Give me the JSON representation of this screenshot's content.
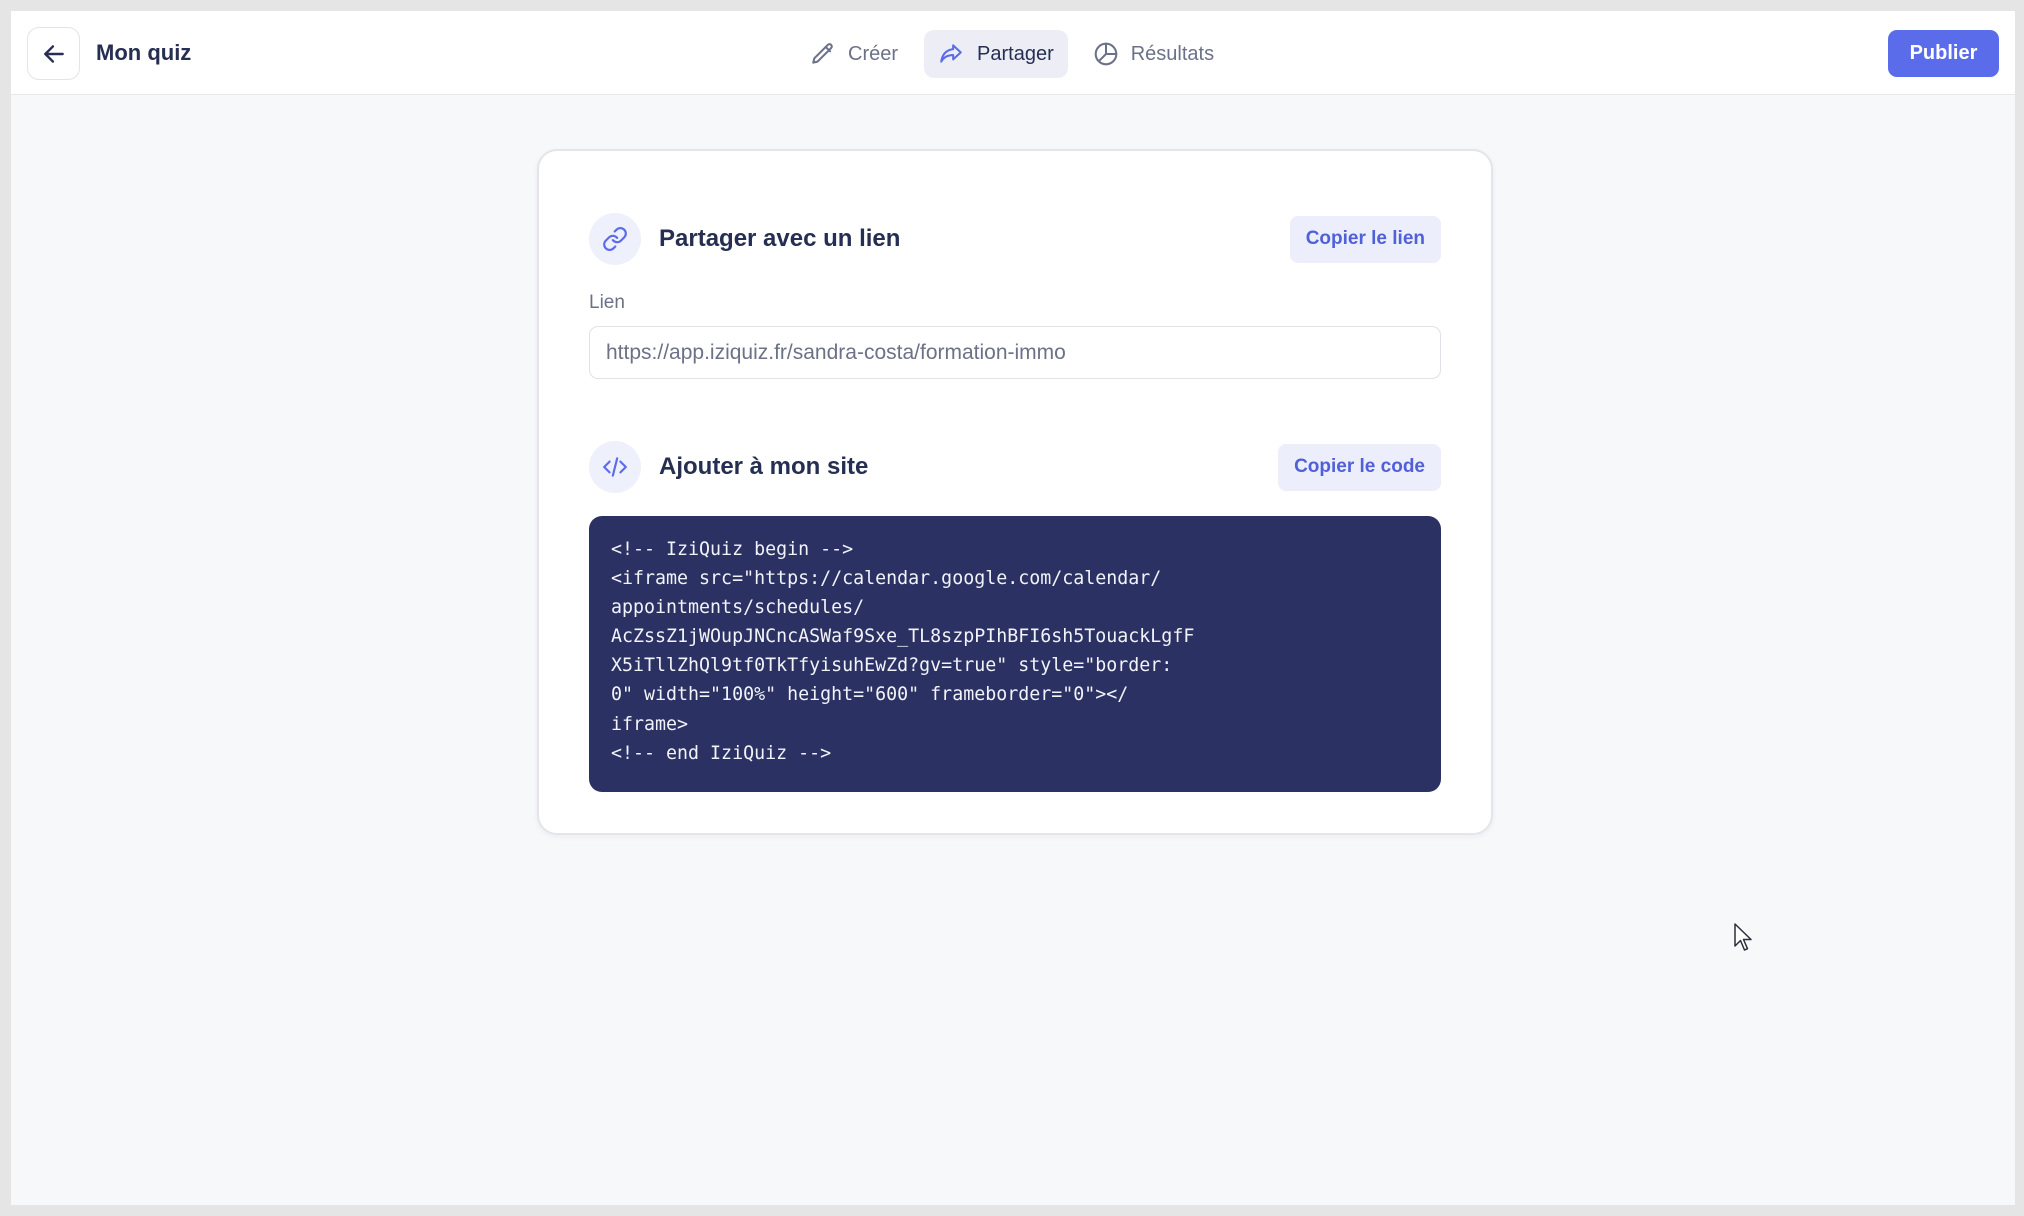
{
  "header": {
    "title": "Mon quiz",
    "publish_label": "Publier",
    "tabs": [
      {
        "label": "Créer",
        "icon": "pencil-icon",
        "active": false
      },
      {
        "label": "Partager",
        "icon": "share-icon",
        "active": true
      },
      {
        "label": "Résultats",
        "icon": "chart-pie-icon",
        "active": false
      }
    ]
  },
  "share_link": {
    "title": "Partager avec un lien",
    "copy_label": "Copier le lien",
    "field_label": "Lien",
    "url": "https://app.iziquiz.fr/sandra-costa/formation-immo"
  },
  "embed": {
    "title": "Ajouter à mon site",
    "copy_label": "Copier le code",
    "code_lines": [
      "<!-- IziQuiz begin -->",
      "<iframe src=\"https://calendar.google.com/calendar/",
      "appointments/schedules/",
      "AcZssZ1jWOupJNCncASWaf9Sxe_TL8szpPIhBFI6sh5TouackLgfF",
      "X5iTllZhQl9tf0TkTfyisuhEwZd?gv=true\" style=\"border:",
      "0\" width=\"100%\" height=\"600\" frameborder=\"0\"></",
      "iframe>",
      "<!-- end IziQuiz -->"
    ]
  },
  "colors": {
    "accent": "#5b6ceb",
    "code_bg": "#2b3263",
    "title_text": "#262f52",
    "muted_text": "#6b7287"
  }
}
